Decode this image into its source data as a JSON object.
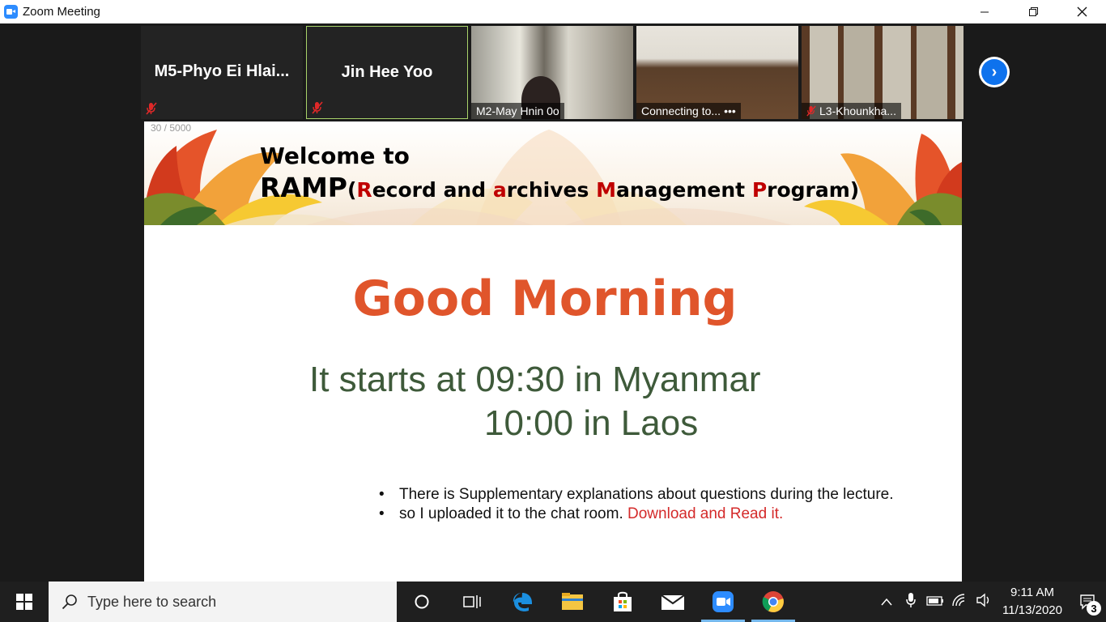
{
  "window": {
    "title": "Zoom Meeting",
    "minimize_icon": "minimize-icon",
    "restore_icon": "restore-icon",
    "close_icon": "close-icon"
  },
  "participants": [
    {
      "name": "M5-Phyo  Ei  Hlai...",
      "muted": true,
      "video": false
    },
    {
      "name": "Jin  Hee Yoo",
      "muted": true,
      "video": false,
      "active_speaker": true
    },
    {
      "name": "M2-May Hnin 0o",
      "muted": false,
      "video": true
    },
    {
      "name": "Connecting to...",
      "muted": false,
      "video": true,
      "menu_label": "•••"
    },
    {
      "name": "L3-Khounkha...",
      "muted": true,
      "video": true
    }
  ],
  "slide": {
    "counter": "30 / 5000",
    "welcome": "Welcome to",
    "ramp": {
      "abbr": "RAMP",
      "open": "(",
      "r": "R",
      "ecord": "ecord and ",
      "a": "a",
      "rchives": "rchives ",
      "m": "M",
      "anagement": "anagement ",
      "p": "P",
      "rogram": "rogram)"
    },
    "greeting": "Good Morning",
    "start_line_1": "It starts at 09:30 in Myanmar",
    "start_line_2": "10:00 in Laos",
    "bullet_1": "There is Supplementary explanations about questions during the lecture.",
    "bullet_2_prefix": "so I uploaded it to the chat room. ",
    "bullet_2_highlight": "Download and Read it.",
    "bullet_char": "•"
  },
  "taskbar": {
    "search_placeholder": "Type here to search",
    "time": "9:11 AM",
    "date": "11/13/2020",
    "notification_count": "3"
  },
  "colors": {
    "greeting": "#e0552b",
    "start_text": "#3e5a3a",
    "highlight_red": "#d42a2a",
    "zoom_blue": "#0e72ed",
    "active_border": "#a8d36a"
  }
}
